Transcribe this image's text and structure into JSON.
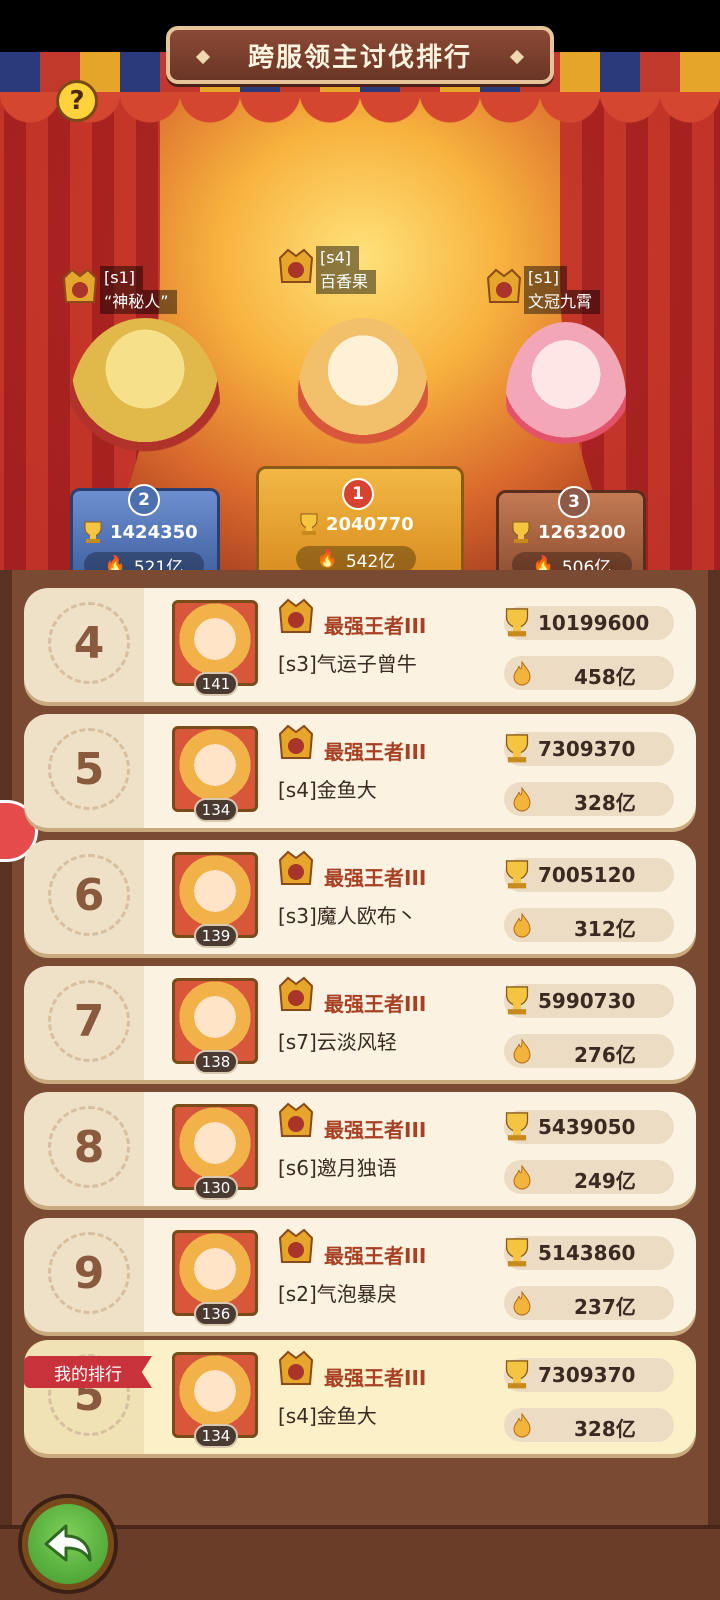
{
  "title": "跨服领主讨伐排行",
  "help": "?",
  "podium": [
    {
      "rank": "2",
      "tag": "[s1]",
      "name": "“神秘人”",
      "score": "1424350",
      "power": "521亿"
    },
    {
      "rank": "1",
      "tag": "[s4]",
      "name": "百香果",
      "score": "2040770",
      "power": "542亿"
    },
    {
      "rank": "3",
      "tag": "[s1]",
      "name": "文冠九霄",
      "score": "1263200",
      "power": "506亿"
    }
  ],
  "rows": [
    {
      "rank": "4",
      "level": "141",
      "tier": "最强王者III",
      "name": "[s3]气运子曾牛",
      "score": "10199600",
      "power": "458亿"
    },
    {
      "rank": "5",
      "level": "134",
      "tier": "最强王者III",
      "name": "[s4]金鱼大",
      "score": "7309370",
      "power": "328亿"
    },
    {
      "rank": "6",
      "level": "139",
      "tier": "最强王者III",
      "name": "[s3]魔人欧布丶",
      "score": "7005120",
      "power": "312亿"
    },
    {
      "rank": "7",
      "level": "138",
      "tier": "最强王者III",
      "name": "[s7]云淡风轻",
      "score": "5990730",
      "power": "276亿"
    },
    {
      "rank": "8",
      "level": "130",
      "tier": "最强王者III",
      "name": "[s6]邀月独语",
      "score": "5439050",
      "power": "249亿"
    },
    {
      "rank": "9",
      "level": "136",
      "tier": "最强王者III",
      "name": "[s2]气泡暴戾",
      "score": "5143860",
      "power": "237亿"
    }
  ],
  "mine": {
    "ribbon": "我的排行",
    "rank": "5",
    "level": "134",
    "tier": "最强王者III",
    "name": "[s4]金鱼大",
    "score": "7309370",
    "power": "328亿"
  },
  "colors": {
    "gold": "#e6a52b",
    "blue": "#4c6fb0",
    "bronze": "#a85a3a",
    "tier_red": "#a84024"
  }
}
